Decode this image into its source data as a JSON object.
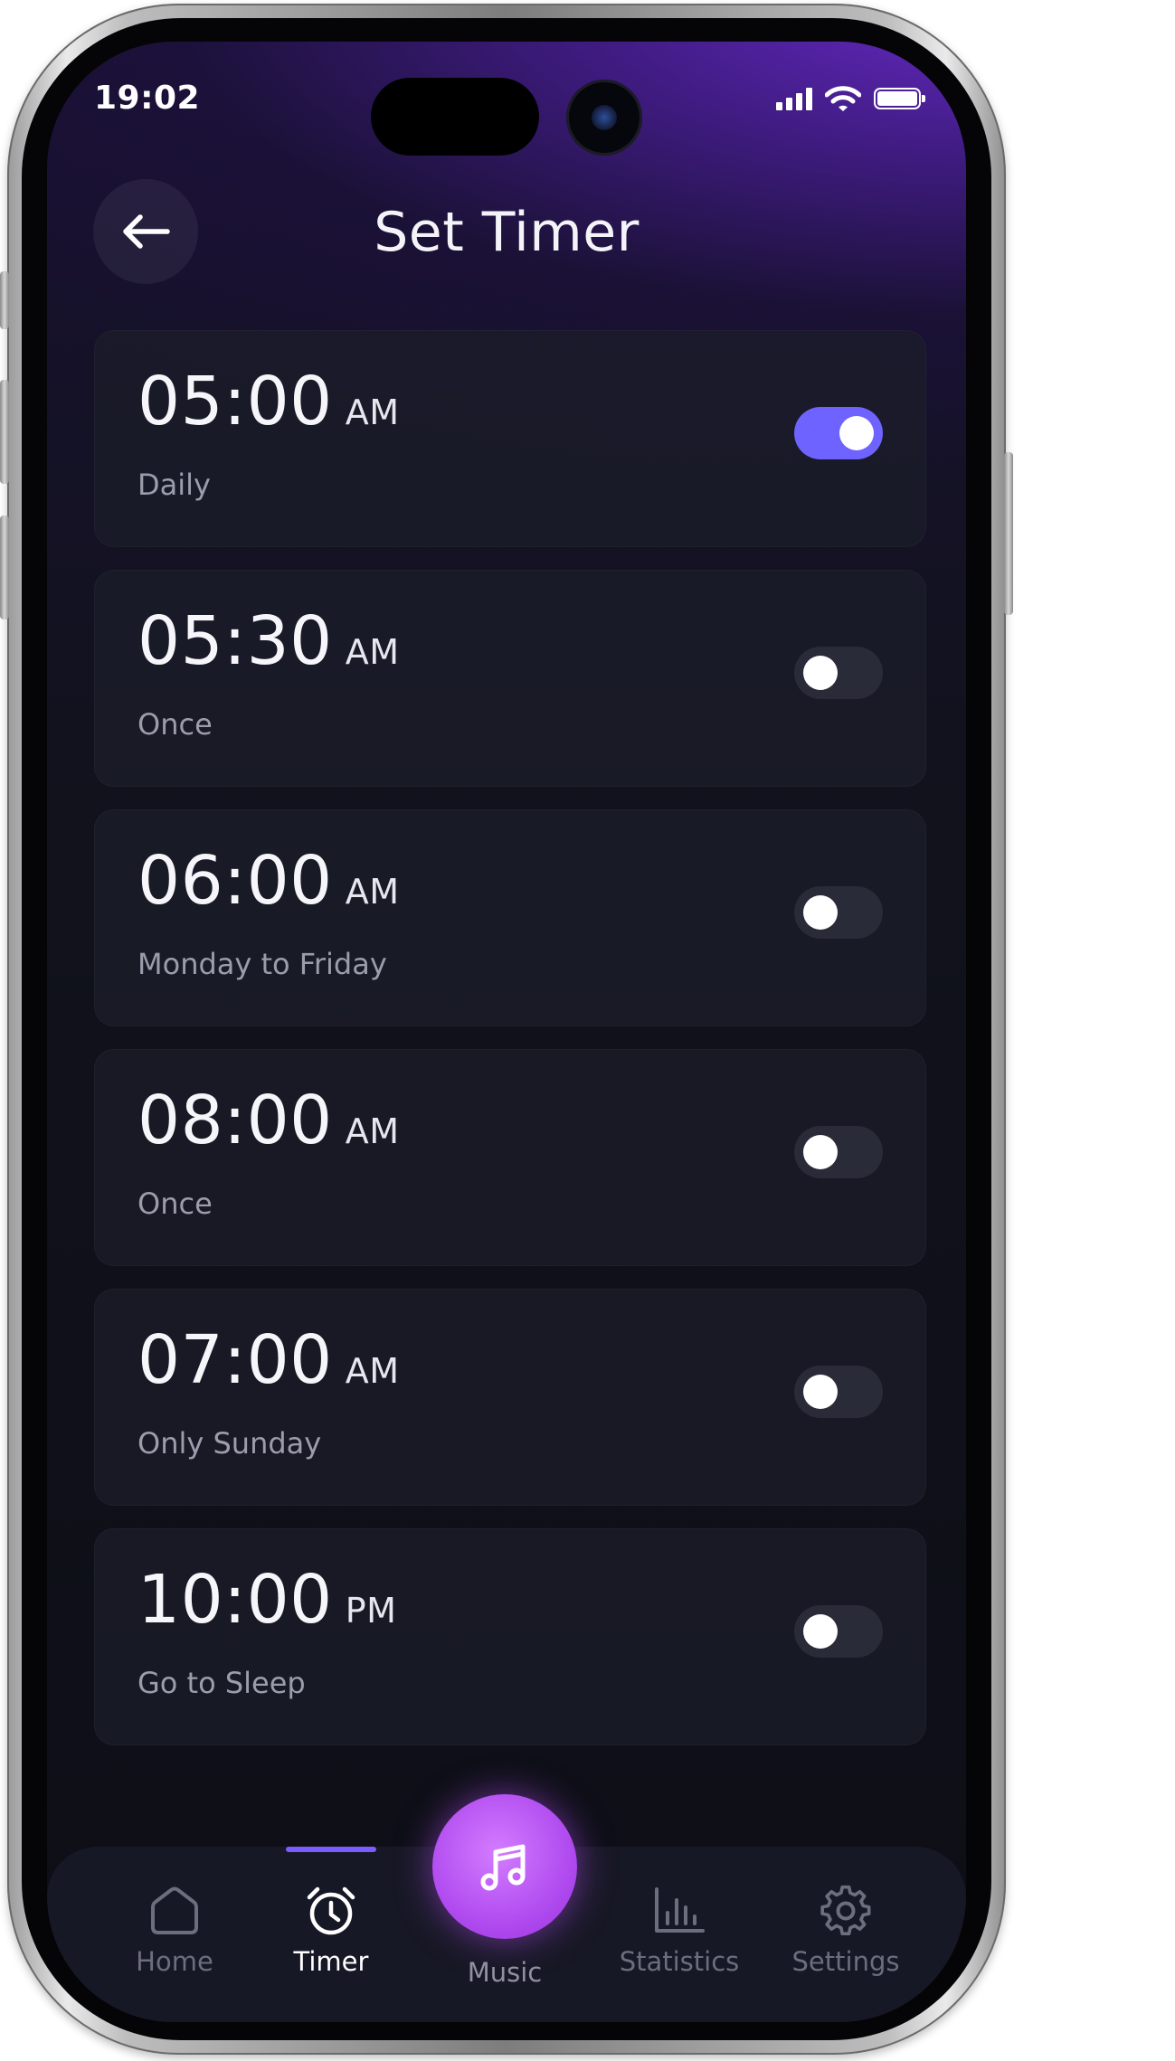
{
  "status_bar": {
    "time": "19:02"
  },
  "header": {
    "title": "Set Timer"
  },
  "timers": [
    {
      "time": "05:00",
      "period": "AM",
      "label": "Daily",
      "enabled": true
    },
    {
      "time": "05:30",
      "period": "AM",
      "label": "Once",
      "enabled": false
    },
    {
      "time": "06:00",
      "period": "AM",
      "label": "Monday to Friday",
      "enabled": false
    },
    {
      "time": "08:00",
      "period": "AM",
      "label": "Once",
      "enabled": false
    },
    {
      "time": "07:00",
      "period": "AM",
      "label": "Only Sunday",
      "enabled": false
    },
    {
      "time": "10:00",
      "period": "PM",
      "label": "Go to Sleep",
      "enabled": false
    }
  ],
  "bottom_nav": {
    "home": "Home",
    "timer": "Timer",
    "music": "Music",
    "statistics": "Statistics",
    "settings": "Settings",
    "active": "timer"
  },
  "icons": {
    "back": "back-arrow-icon",
    "home": "home-icon",
    "timer": "alarm-clock-icon",
    "music": "music-note-icon",
    "statistics": "bar-chart-icon",
    "settings": "gear-icon"
  },
  "colors": {
    "accent": "#6f63ff",
    "music_button": "#b14cf0",
    "toggle_off": "#2a2b38",
    "background": "#0d0e16"
  }
}
